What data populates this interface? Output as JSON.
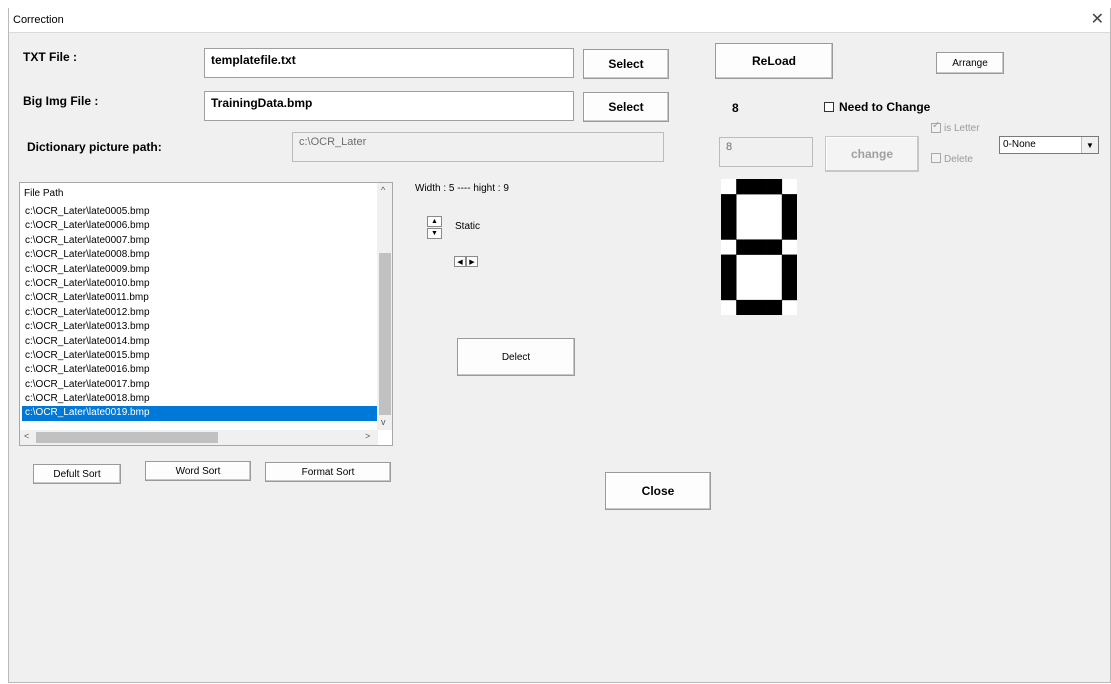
{
  "window": {
    "title": "Correction",
    "close_glyph": "✕"
  },
  "txt_file": {
    "label": "TXT File :",
    "value": "templatefile.txt",
    "button": "Select"
  },
  "big_img_file": {
    "label": "Big Img File :",
    "value": "TrainingData.bmp",
    "button": "Select"
  },
  "dictionary": {
    "label": "Dictionary picture path:",
    "value": "c:\\OCR_Later"
  },
  "reload_button": "ReLoad",
  "arrange_button": "Arrange",
  "current_char": "8",
  "need_to_change": {
    "label": "Need to Change",
    "checked": false
  },
  "char_field": "8",
  "change_button": "change",
  "is_letter": {
    "label": "is Letter",
    "checked": true
  },
  "delete": {
    "label": "Delete",
    "checked": false
  },
  "combo": {
    "selected": "0-None"
  },
  "file_list": {
    "header": "File Path",
    "items": [
      "c:\\OCR_Later\\late0005.bmp",
      "c:\\OCR_Later\\late0006.bmp",
      "c:\\OCR_Later\\late0007.bmp",
      "c:\\OCR_Later\\late0008.bmp",
      "c:\\OCR_Later\\late0009.bmp",
      "c:\\OCR_Later\\late0010.bmp",
      "c:\\OCR_Later\\late0011.bmp",
      "c:\\OCR_Later\\late0012.bmp",
      "c:\\OCR_Later\\late0013.bmp",
      "c:\\OCR_Later\\late0014.bmp",
      "c:\\OCR_Later\\late0015.bmp",
      "c:\\OCR_Later\\late0016.bmp",
      "c:\\OCR_Later\\late0017.bmp",
      "c:\\OCR_Later\\late0018.bmp",
      "c:\\OCR_Later\\late0019.bmp"
    ],
    "selected_index": 14
  },
  "size_info": "Width : 5 ---- hight : 9",
  "static_label": "Static",
  "detect_button": "Delect",
  "sort_buttons": {
    "default": "Defult Sort",
    "word": "Word Sort",
    "format": "Format Sort"
  },
  "close_button": "Close",
  "digit_bitmap": {
    "cols": 5,
    "rows": 9,
    "pixels": [
      "01110",
      "10001",
      "10001",
      "10001",
      "01110",
      "10001",
      "10001",
      "10001",
      "01110"
    ]
  },
  "icons": {
    "up": "▲",
    "down": "▼",
    "left": "◀",
    "right": "▶",
    "scroll_up": "^",
    "scroll_down": "v",
    "scroll_left": "<",
    "scroll_right": ">",
    "combo_arrow": "▼",
    "checkmark": "✓"
  }
}
